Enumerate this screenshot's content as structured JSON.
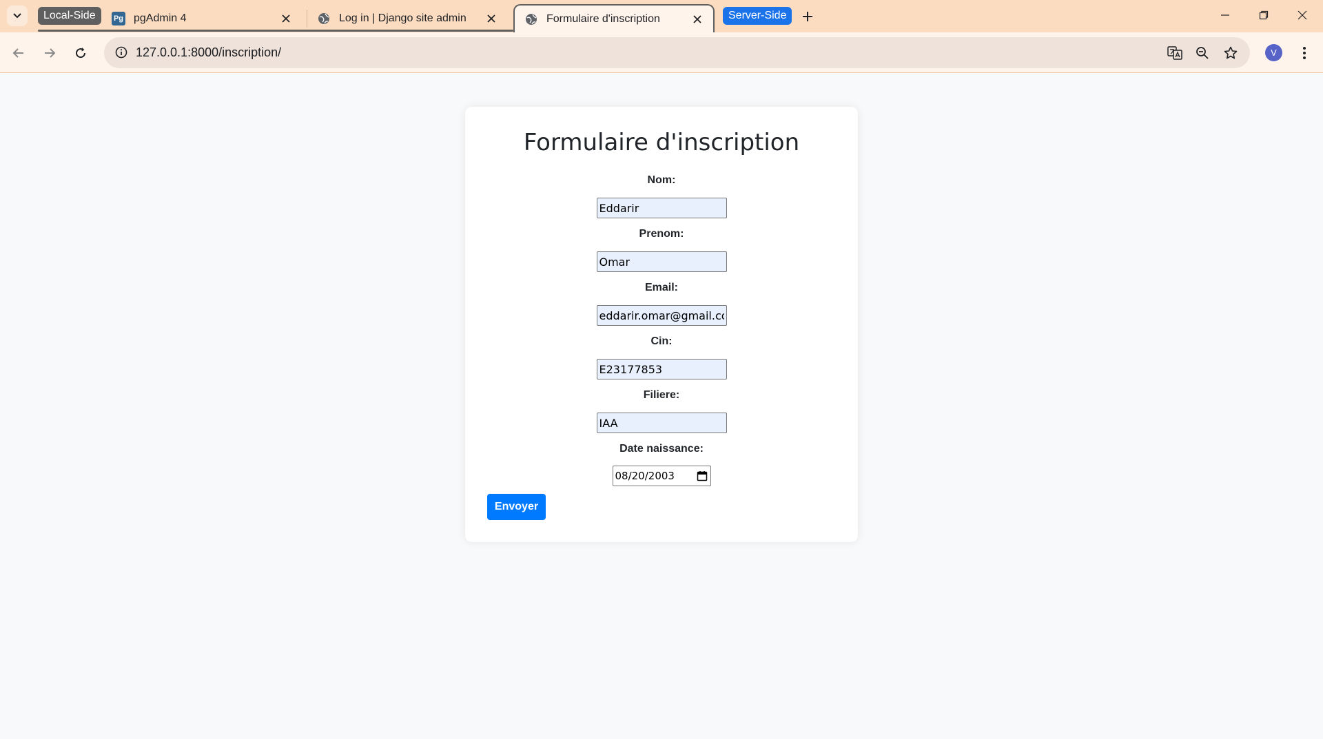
{
  "browser": {
    "tab_groups": [
      {
        "label": "Local-Side",
        "color": "#5f5f5f"
      },
      {
        "label": "Server-Side",
        "color": "#1a73e8"
      }
    ],
    "tabs": [
      {
        "title": "pgAdmin 4",
        "favicon": "Pg"
      },
      {
        "title": "Log in | Django site admin",
        "favicon": "globe-icon"
      },
      {
        "title": "Formulaire d'inscription",
        "favicon": "globe-icon",
        "active": true
      }
    ],
    "url": "127.0.0.1:8000/inscription/",
    "profile_initial": "V"
  },
  "form": {
    "title": "Formulaire d'inscription",
    "fields": [
      {
        "label": "Nom:",
        "value": "Eddarir"
      },
      {
        "label": "Prenom:",
        "value": "Omar"
      },
      {
        "label": "Email:",
        "value": "eddarir.omar@gmail.com"
      },
      {
        "label": "Cin:",
        "value": "E23177853"
      },
      {
        "label": "Filiere:",
        "value": "IAA"
      },
      {
        "label": "Date naissance:",
        "value": "08/20/2003"
      }
    ],
    "submit_label": "Envoyer"
  },
  "colors": {
    "accent": "#007bff",
    "tabstrip": "#fcdcc0",
    "page_bg": "#f8f9fa"
  }
}
